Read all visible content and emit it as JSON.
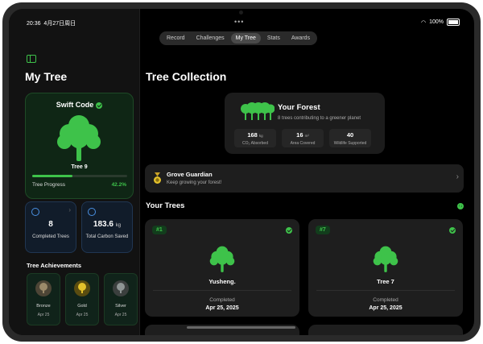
{
  "status_bar": {
    "time": "20:36",
    "date": "4月27日周日",
    "battery": "100%"
  },
  "nav": {
    "tabs": [
      "Record",
      "Challenges",
      "My Tree",
      "Stats",
      "Awards"
    ],
    "active": "My Tree"
  },
  "sidebar": {
    "title": "My Tree",
    "tree_card": {
      "title": "Swift Code",
      "tree_name": "Tree 9",
      "progress_label": "Tree Progress",
      "progress_value": "42.2%",
      "progress_fraction": 0.422
    },
    "stats": [
      {
        "value": "8",
        "unit": "",
        "label": "Completed Trees"
      },
      {
        "value": "183.6",
        "unit": "kg",
        "label": "Total Carbon Saved"
      }
    ],
    "achievements_title": "Tree Achievements",
    "achievements": [
      {
        "name": "Bronze",
        "date": "Apr 25",
        "color": "#9c8a6a"
      },
      {
        "name": "Gold",
        "date": "Apr 25",
        "color": "#e3c12b"
      },
      {
        "name": "Silver",
        "date": "Apr 25",
        "color": "#8e9594"
      }
    ]
  },
  "main": {
    "title": "Tree Collection",
    "forest": {
      "title": "Your Forest",
      "subtitle": "8 trees contributing to a greener planet",
      "stats": [
        {
          "value": "168",
          "unit": "kg",
          "label": "CO₂ Absorbed"
        },
        {
          "value": "16",
          "unit": "m²",
          "label": "Area Covered"
        },
        {
          "value": "40",
          "unit": "",
          "label": "Wildlife Supported"
        }
      ]
    },
    "guardian": {
      "title": "Grove Guardian",
      "subtitle": "Keep growing your forest!"
    },
    "your_trees_title": "Your Trees",
    "tree_count": "↑↓",
    "trees": [
      {
        "number": "#1",
        "name": "Yusheng.",
        "status": "Completed",
        "date": "Apr 25, 2025"
      },
      {
        "number": "#7",
        "name": "Tree 7",
        "status": "Completed",
        "date": "Apr 25, 2025"
      }
    ]
  },
  "colors": {
    "accent": "#3ec24a",
    "background": "#000000",
    "card": "#1e1e1e",
    "blue": "#4a90e2"
  }
}
